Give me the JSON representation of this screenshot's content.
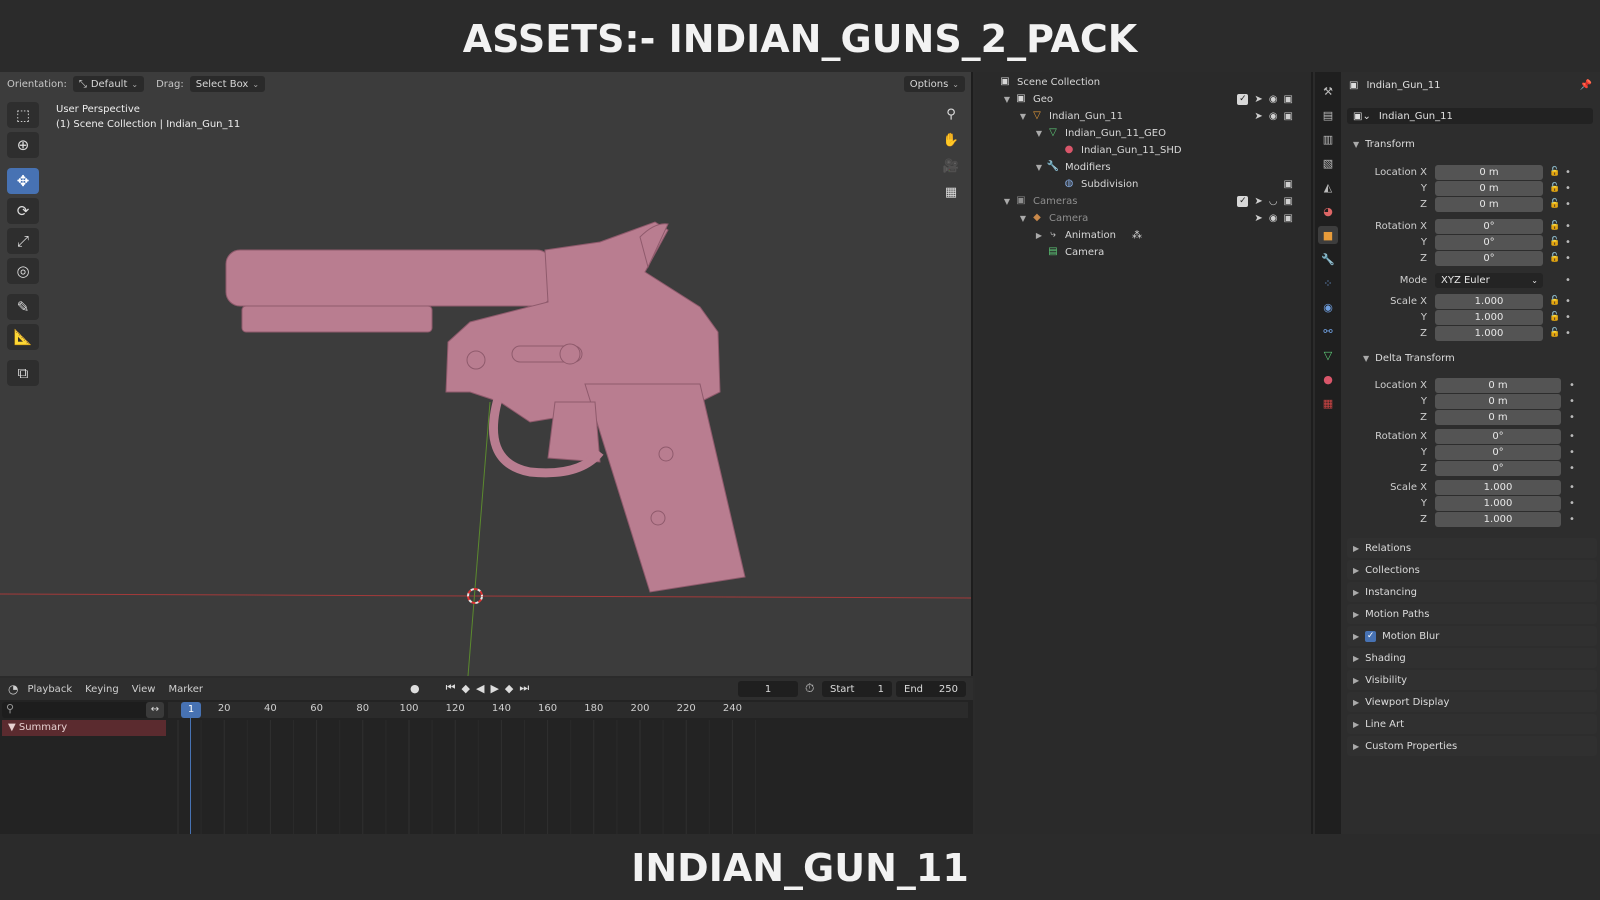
{
  "banner": {
    "top": "ASSETS:- INDIAN_GUNS_2_PACK",
    "bottom": "INDIAN_GUN_11"
  },
  "viewport": {
    "orientation_label": "Orientation:",
    "orientation_value": "Default",
    "drag_label": "Drag:",
    "drag_value": "Select Box",
    "options": "Options",
    "info_line1": "User Perspective",
    "info_line2": "(1) Scene Collection | Indian_Gun_11",
    "model_color": "#b97d90"
  },
  "timeline": {
    "menus": [
      "Playback",
      "Keying",
      "View",
      "Marker"
    ],
    "current_frame": "1",
    "start_label": "Start",
    "start_value": "1",
    "end_label": "End",
    "end_value": "250",
    "ticks": [
      "20",
      "40",
      "60",
      "80",
      "100",
      "120",
      "140",
      "160",
      "180",
      "200",
      "220",
      "240"
    ],
    "cursor_frame": "1",
    "summary": "Summary"
  },
  "outliner": {
    "root": "Scene Collection",
    "rows": [
      {
        "label": "Geo",
        "icon": "collection-icon"
      },
      {
        "label": "Indian_Gun_11",
        "icon": "object-icon"
      },
      {
        "label": "Indian_Gun_11_GEO",
        "icon": "mesh-icon"
      },
      {
        "label": "Indian_Gun_11_SHD",
        "icon": "material-icon"
      },
      {
        "label": "Modifiers",
        "icon": "wrench-icon"
      },
      {
        "label": "Subdivision",
        "icon": "modifier-icon"
      },
      {
        "label": "Cameras",
        "icon": "collection-icon"
      },
      {
        "label": "Camera",
        "icon": "camera-object-icon"
      },
      {
        "label": "Animation",
        "icon": "animation-icon"
      },
      {
        "label": "Camera",
        "icon": "camera-data-icon"
      }
    ]
  },
  "properties": {
    "object_name": "Indian_Gun_11",
    "data_name": "Indian_Gun_11",
    "transform": {
      "title": "Transform",
      "location_label": "Location X",
      "location": [
        "0 m",
        "0 m",
        "0 m"
      ],
      "rotation_label": "Rotation X",
      "rotation": [
        "0°",
        "0°",
        "0°"
      ],
      "mode_label": "Mode",
      "mode_value": "XYZ Euler",
      "scale_label": "Scale X",
      "scale": [
        "1.000",
        "1.000",
        "1.000"
      ],
      "y_label": "Y",
      "z_label": "Z"
    },
    "delta": {
      "title": "Delta Transform",
      "location": [
        "0 m",
        "0 m",
        "0 m"
      ],
      "rotation": [
        "0°",
        "0°",
        "0°"
      ],
      "scale": [
        "1.000",
        "1.000",
        "1.000"
      ]
    },
    "panels": [
      "Relations",
      "Collections",
      "Instancing",
      "Motion Paths",
      "Motion Blur",
      "Shading",
      "Visibility",
      "Viewport Display",
      "Line Art",
      "Custom Properties"
    ]
  }
}
